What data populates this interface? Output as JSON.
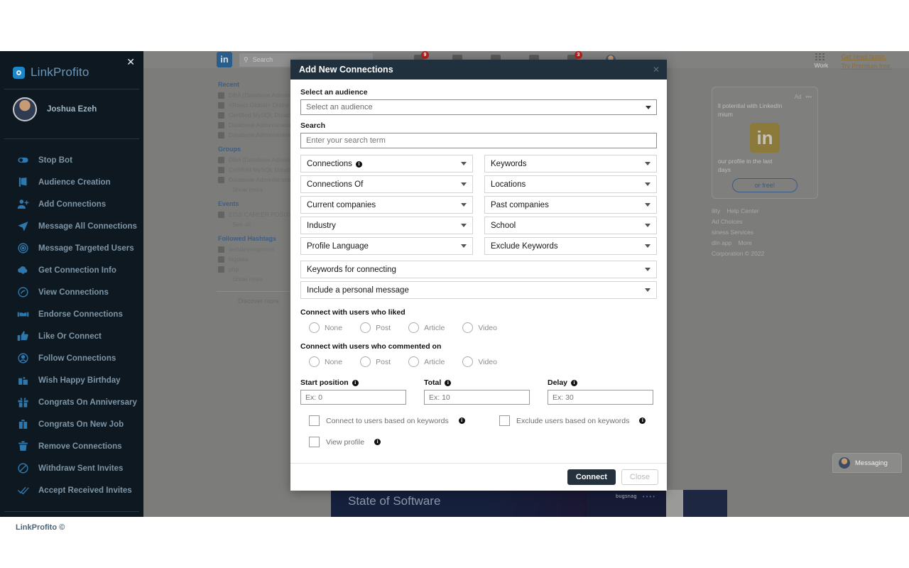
{
  "sidebar": {
    "brand": "LinkProfito",
    "close_label": "✕",
    "user_name": "Joshua Ezeh",
    "footer": "LinkProfito ©",
    "items": [
      {
        "label": "Stop Bot",
        "icon": "toggle-icon"
      },
      {
        "label": "Audience Creation",
        "icon": "megaphone-icon"
      },
      {
        "label": "Add Connections",
        "icon": "person-add-icon"
      },
      {
        "label": "Message All Connections",
        "icon": "send-icon"
      },
      {
        "label": "Message Targeted Users",
        "icon": "target-icon"
      },
      {
        "label": "Get Connection Info",
        "icon": "cloud-download-icon"
      },
      {
        "label": "View Connections",
        "icon": "eye-icon"
      },
      {
        "label": "Endorse Connections",
        "icon": "handshake-icon"
      },
      {
        "label": "Like Or Connect",
        "icon": "thumbs-up-icon"
      },
      {
        "label": "Follow Connections",
        "icon": "user-circle-icon"
      },
      {
        "label": "Wish Happy Birthday",
        "icon": "cake-icon"
      },
      {
        "label": "Congrats On Anniversary",
        "icon": "gift-icon"
      },
      {
        "label": "Congrats On New Job",
        "icon": "briefcase-icon"
      },
      {
        "label": "Remove Connections",
        "icon": "trash-icon"
      },
      {
        "label": "Withdraw Sent Invites",
        "icon": "block-icon"
      },
      {
        "label": "Accept Received Invites",
        "icon": "double-check-icon"
      }
    ]
  },
  "modal": {
    "title": "Add New Connections",
    "close_label": "✕",
    "audience_label": "Select an audience",
    "audience_value": "Select an audience",
    "search_label": "Search",
    "search_placeholder": "Enter your search term",
    "filters_left": [
      {
        "label": "Connections",
        "info": true
      },
      {
        "label": "Connections Of",
        "info": false
      },
      {
        "label": "Current companies",
        "info": false
      },
      {
        "label": "Industry",
        "info": false
      },
      {
        "label": "Profile Language",
        "info": false
      }
    ],
    "filters_right": [
      {
        "label": "Keywords",
        "info": false
      },
      {
        "label": "Locations",
        "info": false
      },
      {
        "label": "Past companies",
        "info": false
      },
      {
        "label": "School",
        "info": false
      },
      {
        "label": "Exclude Keywords",
        "info": false
      }
    ],
    "filters_wide": [
      {
        "label": "Keywords for connecting"
      },
      {
        "label": "Include a personal message"
      }
    ],
    "liked_label": "Connect with users who liked",
    "liked_options": [
      "None",
      "Post",
      "Article",
      "Video"
    ],
    "commented_label": "Connect with users who commented on",
    "commented_options": [
      "None",
      "Post",
      "Article",
      "Video"
    ],
    "numeric": [
      {
        "label": "Start position",
        "placeholder": "Ex: 0"
      },
      {
        "label": "Total",
        "placeholder": "Ex: 10"
      },
      {
        "label": "Delay",
        "placeholder": "Ex: 30"
      }
    ],
    "checkboxes": [
      {
        "label": "Connect to users based on keywords"
      },
      {
        "label": "Exclude users based on keywords"
      },
      {
        "label": "View profile"
      }
    ],
    "connect_label": "Connect",
    "close_button_label": "Close"
  },
  "linkedin": {
    "logo": "in",
    "search_placeholder": "Search",
    "nav_badges": [
      "9",
      "",
      "",
      "",
      "3"
    ],
    "work_label": "Work",
    "premium_links": [
      "Get hired faster.",
      "Try Premium free."
    ],
    "left": {
      "recent_heading": "Recent",
      "recent": [
        "DBA (Database Administ",
        "<React Global> Online S",
        "Certified MySQL Databa",
        "Database Administrator",
        "Database Administrator"
      ],
      "groups_heading": "Groups",
      "groups": [
        "DBA (Database Administ",
        "Certified MySQL Databa",
        "Database Administrator"
      ],
      "show_more": "Show more",
      "events_heading": "Events",
      "events": [
        "EISS CAREER POSITIONI"
      ],
      "see_all": "See all",
      "hashtags_heading": "Followed Hashtags",
      "hashtags": [
        "webdevelopment",
        "bigdata",
        "php"
      ],
      "discover": "Discover more"
    },
    "ad": {
      "ad_label": "Ad",
      "menu": "•••",
      "headline": "ll potential with LinkedIn",
      "headline2": "mium",
      "logo": "in",
      "body": "our profile in the last",
      "body2": "days",
      "cta": "or free!"
    },
    "footer_links": [
      "ility",
      "Help Center",
      "Ad Choices",
      "siness Services",
      "dIn app",
      "More"
    ],
    "footer_copy": "Corporation © 2022",
    "promo_title": "State of Software",
    "promo_brand": "bugsnag",
    "messaging_label": "Messaging"
  }
}
